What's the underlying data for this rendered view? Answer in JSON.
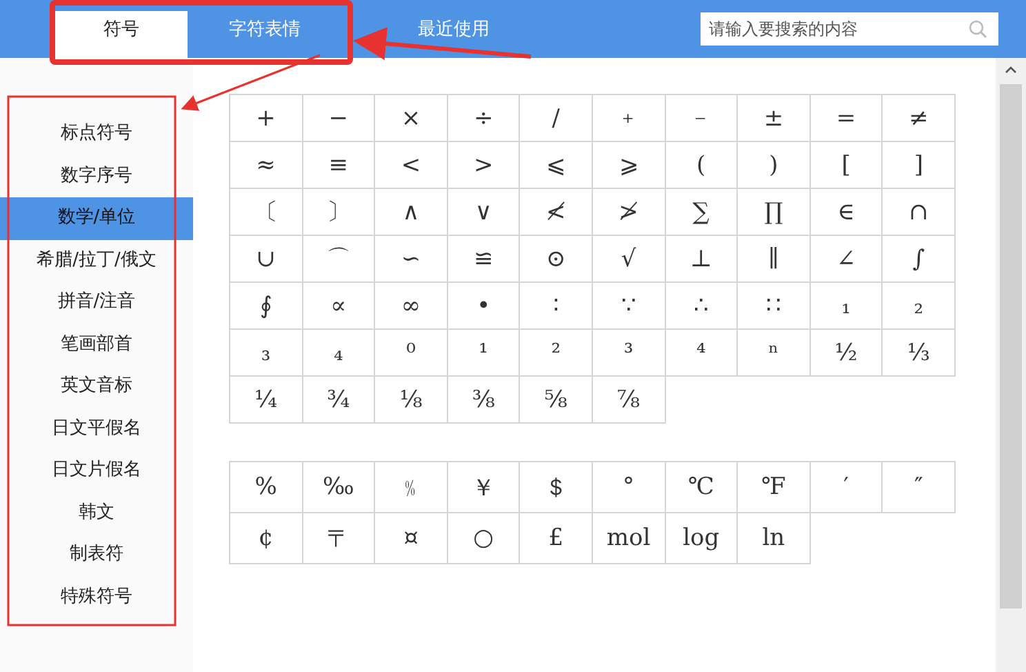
{
  "tabs": [
    {
      "label": "符号",
      "selected": true
    },
    {
      "label": "字符表情",
      "selected": false
    },
    {
      "label": "最近使用",
      "selected": false
    }
  ],
  "search": {
    "placeholder": "请输入要搜索的内容"
  },
  "sidebar": {
    "items": [
      {
        "label": "标点符号",
        "selected": false
      },
      {
        "label": "数字序号",
        "selected": false
      },
      {
        "label": "数学/单位",
        "selected": true
      },
      {
        "label": "希腊/拉丁/俄文",
        "selected": false
      },
      {
        "label": "拼音/注音",
        "selected": false
      },
      {
        "label": "笔画部首",
        "selected": false
      },
      {
        "label": "英文音标",
        "selected": false
      },
      {
        "label": "日文平假名",
        "selected": false
      },
      {
        "label": "日文片假名",
        "selected": false
      },
      {
        "label": "韩文",
        "selected": false
      },
      {
        "label": "制表符",
        "selected": false
      },
      {
        "label": "特殊符号",
        "selected": false
      }
    ]
  },
  "symbol_grids": [
    {
      "cells": [
        "+",
        "−",
        "×",
        "÷",
        "/",
        "﹢",
        "﹣",
        "±",
        "=",
        "≠",
        "≈",
        "≡",
        "<",
        ">",
        "⩽",
        "⩾",
        "(",
        ")",
        "[",
        "]",
        "〔",
        "〕",
        "∧",
        "∨",
        "≮",
        "≯",
        "∑",
        "∏",
        "∈",
        "∩",
        "∪",
        "⌒",
        "∽",
        "≌",
        "⊙",
        "√",
        "⊥",
        "∥",
        "∠",
        "∫",
        "∮",
        "∝",
        "∞",
        "•",
        "∶",
        "∵",
        "∴",
        "∷",
        "₁",
        "₂",
        "₃",
        "₄",
        "⁰",
        "¹",
        "²",
        "³",
        "⁴",
        "ⁿ",
        "½",
        "⅓",
        "¼",
        "¾",
        "⅛",
        "⅜",
        "⅝",
        "⅞"
      ]
    },
    {
      "cells": [
        "%",
        "‰",
        "﹪",
        "￥",
        "＄",
        "°",
        "℃",
        "℉",
        "′",
        "″",
        "¢",
        "〒",
        "¤",
        "○",
        "£",
        "mol",
        "log",
        "ln"
      ]
    }
  ]
}
